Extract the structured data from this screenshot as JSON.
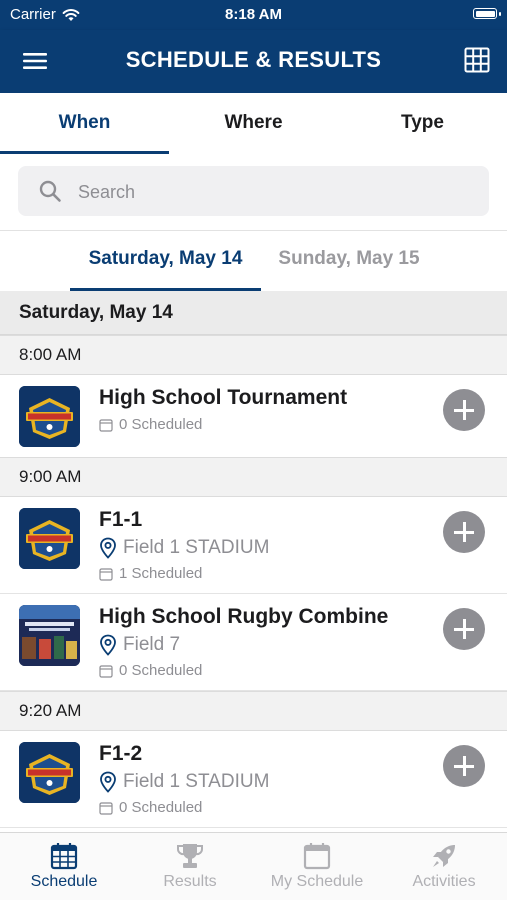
{
  "status_bar": {
    "carrier": "Carrier",
    "time": "8:18 AM"
  },
  "nav": {
    "title": "SCHEDULE & RESULTS",
    "menu_icon": "hamburger-menu-icon",
    "grid_icon": "grid-icon"
  },
  "filter_tabs": [
    {
      "label": "When",
      "active": true
    },
    {
      "label": "Where",
      "active": false
    },
    {
      "label": "Type",
      "active": false
    }
  ],
  "search": {
    "placeholder": "Search",
    "value": ""
  },
  "day_tabs": [
    {
      "label": "Saturday, May 14",
      "active": true
    },
    {
      "label": "Sunday, May 15",
      "active": false
    }
  ],
  "list": {
    "date_header": "Saturday, May 14",
    "time_groups": [
      {
        "time": "8:00 AM"
      },
      {
        "time": "9:00 AM"
      },
      {
        "time": "9:20 AM"
      }
    ],
    "events": [
      {
        "title": "High School Tournament",
        "location": "",
        "scheduled": "0 Scheduled"
      },
      {
        "title": "F1-1",
        "location": "Field 1 STADIUM",
        "scheduled": "1 Scheduled"
      },
      {
        "title": "High School Rugby Combine",
        "location": "Field 7",
        "scheduled": "0 Scheduled"
      },
      {
        "title": "F1-2",
        "location": "Field 1 STADIUM",
        "scheduled": "0 Scheduled"
      }
    ]
  },
  "tab_bar": [
    {
      "label": "Schedule",
      "icon": "calendar-grid-icon",
      "active": true
    },
    {
      "label": "Results",
      "icon": "trophy-icon",
      "active": false
    },
    {
      "label": "My Schedule",
      "icon": "calendar-icon",
      "active": false
    },
    {
      "label": "Activities",
      "icon": "rocket-icon",
      "active": false
    }
  ],
  "colors": {
    "brand": "#0a3d73",
    "muted": "#8e8e93",
    "inactive_tab": "#b0b0b4"
  }
}
